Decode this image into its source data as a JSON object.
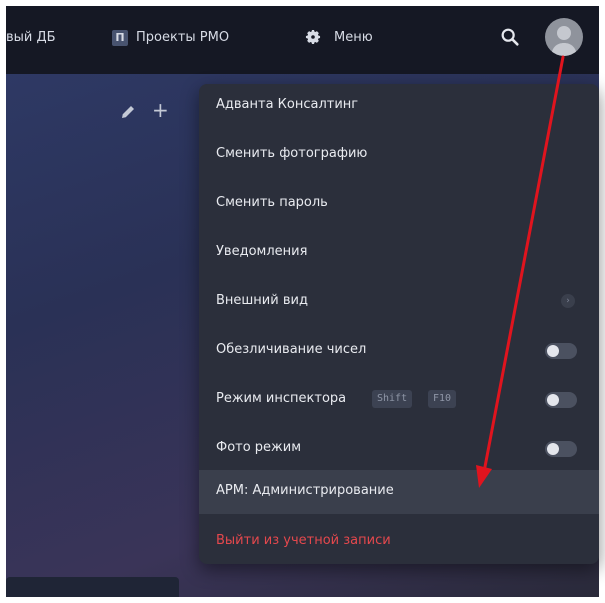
{
  "header": {
    "partial_tab": "вый ДБ",
    "projects_badge": "П",
    "projects_label": "Проекты РМО",
    "menu_label": "Меню",
    "icons": {
      "search": "search-icon",
      "menu": "gear-icon",
      "avatar": "user-avatar-icon"
    }
  },
  "toolbar": {
    "icons": [
      "pencil-icon",
      "plus-icon"
    ]
  },
  "user_menu": {
    "items": [
      {
        "label": "Адванта Консалтинг"
      },
      {
        "label": "Сменить фотографию"
      },
      {
        "label": "Сменить пароль"
      },
      {
        "label": "Уведомления"
      },
      {
        "label": "Внешний вид",
        "control": "chevron"
      },
      {
        "label": "Обезличивание чисел",
        "control": "toggle",
        "on": false
      },
      {
        "label": "Режим инспектора",
        "control": "toggle",
        "on": false,
        "shortcut": [
          "Shift",
          "F10"
        ]
      },
      {
        "label": "Фото режим",
        "control": "toggle",
        "on": false
      },
      {
        "label": "АРМ: Администрирование",
        "highlighted": true
      },
      {
        "label": "Выйти из учетной записи",
        "danger": true
      }
    ]
  },
  "annotation": {
    "type": "arrow",
    "color": "#e0141e",
    "from": "avatar",
    "to": "АРМ: Администрирование"
  },
  "colors": {
    "topbar": "#151824",
    "menu_bg": "#2b2f3b",
    "danger": "#e5484d",
    "annotation": "#e0141e"
  }
}
